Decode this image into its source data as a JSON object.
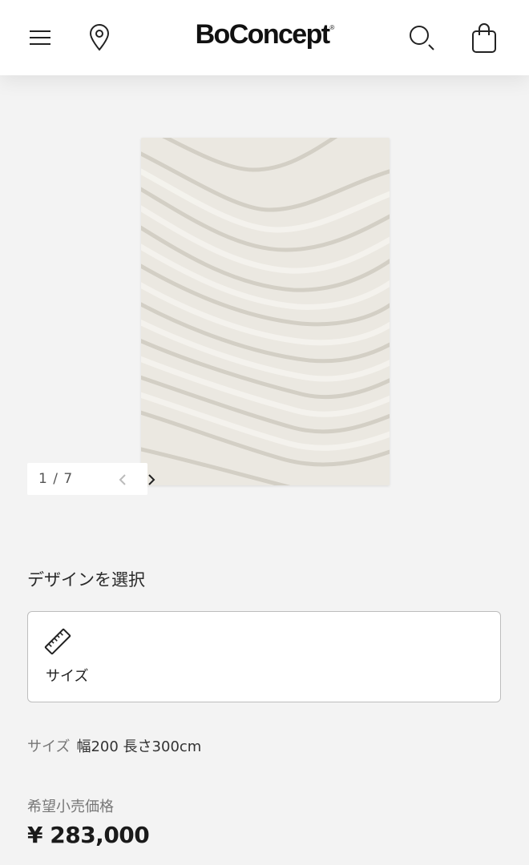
{
  "header": {
    "brand": "BoConcept",
    "brand_mark": "®",
    "icons": [
      "menu-icon",
      "location-pin-icon",
      "search-icon",
      "shopping-bag-icon"
    ]
  },
  "gallery": {
    "counter": "1 / 7",
    "current": 1,
    "total": 7
  },
  "design": {
    "title": "デザインを選択",
    "option_label": "サイズ",
    "option_icon": "ruler-icon"
  },
  "size": {
    "key": "サイズ",
    "value": "幅200 長さ300cm"
  },
  "price": {
    "label": "希望小売価格",
    "value": "¥ 283,000"
  },
  "colors": {
    "background": "#f3f3f3",
    "header": "#ffffff",
    "rug": "#ebe8e1",
    "card_border": "#bdbdbd",
    "muted_text": "#777777"
  }
}
